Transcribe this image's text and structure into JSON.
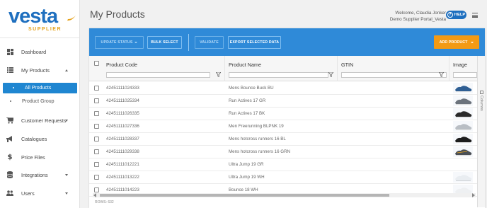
{
  "brand": {
    "name": "vesta",
    "sub": "SUPPLIER",
    "primary": "#1e6fbf",
    "accent": "#e5a21b"
  },
  "sidebar": {
    "items": [
      {
        "label": "Dashboard",
        "icon": "dashboard-icon"
      },
      {
        "label": "My Products",
        "icon": "list-icon",
        "expanded": true
      },
      {
        "label": "All Products",
        "sub": true,
        "active": true
      },
      {
        "label": "Product Group",
        "sub": true
      },
      {
        "label": "Customer Requests",
        "icon": "cart-icon"
      },
      {
        "label": "Catalogues",
        "icon": "megaphone-icon"
      },
      {
        "label": "Price Files",
        "icon": "dollar-icon"
      },
      {
        "label": "Integrations",
        "icon": "database-icon"
      },
      {
        "label": "Users",
        "icon": "users-icon"
      }
    ]
  },
  "header": {
    "title": "My Products",
    "welcome_line1": "Welcome, Claudia Jonker",
    "welcome_line2": "Demo Supplier Portal_Vesta",
    "help_label": "HELP"
  },
  "toolbar": {
    "update_status": "UPDATE STATUS",
    "bulk_select": "BULK SELECT",
    "validate": "VALIDATE",
    "export": "EXPORT SELECTED DATA",
    "add_product": "ADD PRODUCT",
    "bar_color": "#2f8ad8",
    "add_color": "#f39a14"
  },
  "grid": {
    "columns": [
      "Product Code",
      "Product Name",
      "GTIN",
      "Image"
    ],
    "rows": [
      {
        "code": "42451111024333",
        "name": "Mens Bounce Buck BU"
      },
      {
        "code": "42451111025334",
        "name": "Run Actives 17 GR"
      },
      {
        "code": "42451111026335",
        "name": "Run Actives 17 BK"
      },
      {
        "code": "42451111027336",
        "name": "Men Freerunning BLPNK 19"
      },
      {
        "code": "42451111028337",
        "name": "Mens hotcross runners 16 BL"
      },
      {
        "code": "42451111029338",
        "name": "Mens hotcross runners 16 GRN"
      },
      {
        "code": "42451111012221",
        "name": "Ultra Jump 19 GR"
      },
      {
        "code": "42451111013222",
        "name": "Ultra Jump 19 WH"
      },
      {
        "code": "42451111014223",
        "name": "Bounce 18 WH"
      }
    ],
    "rows_label": "ROWS: 632",
    "columns_strip_label": "Columns"
  }
}
